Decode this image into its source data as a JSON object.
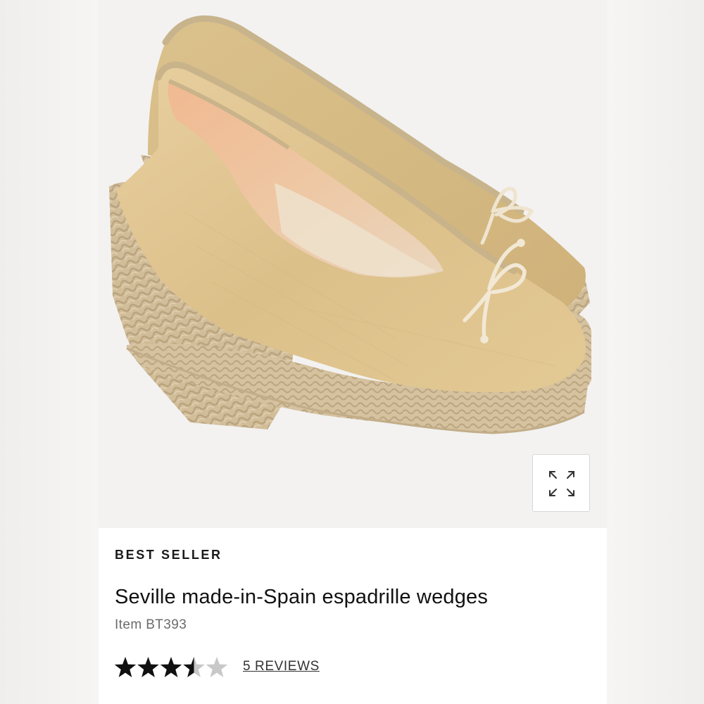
{
  "product": {
    "badge": "BEST SELLER",
    "title": "Seville made-in-Spain espadrille wedges",
    "item_number": "Item BT393",
    "rating": 3.5,
    "rating_max": 5,
    "reviews_link": "5 REVIEWS"
  },
  "image": {
    "subject": "beige linen espadrille wedge pumps with bow detail",
    "zoom_icon": "expand-arrows-icon"
  },
  "colors": {
    "canvas": "#fbcfa1",
    "jute": "#d3bd98",
    "star_filled": "#111111",
    "star_empty": "#c8c8c8"
  }
}
